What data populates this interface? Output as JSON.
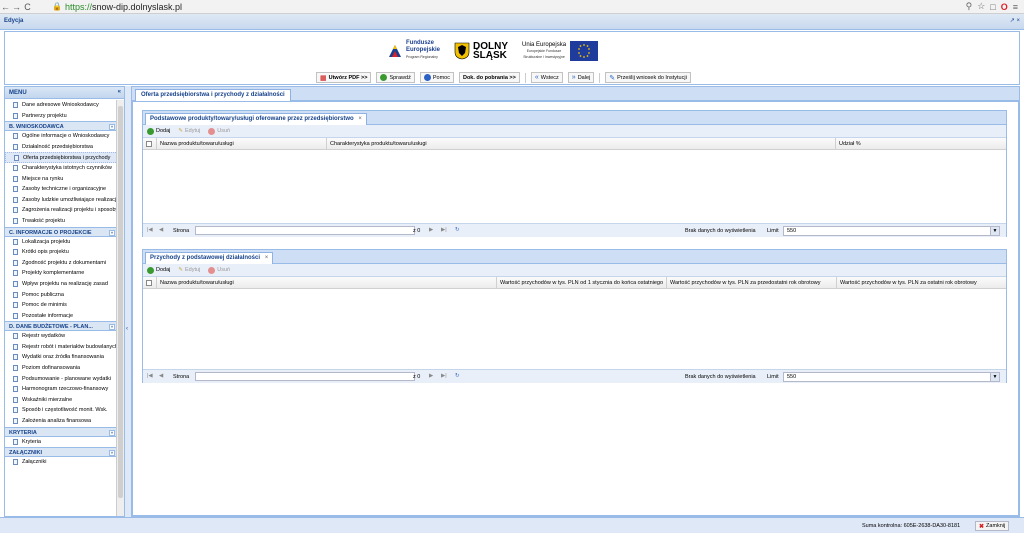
{
  "browser": {
    "back": "←",
    "forward": "→",
    "reload": "C",
    "url_proto": "https://",
    "url_host": "snow-dip.dolnyslask.pl"
  },
  "app": {
    "title": "Edycja",
    "window_icons": "↗ ×"
  },
  "header": {
    "fe_title1": "Fundusze",
    "fe_title2": "Europejskie",
    "fe_sub": "Program Regionalny",
    "ds_line1": "DOLNY",
    "ds_line2": "ŚLĄSK",
    "ue_title": "Unia Europejska",
    "ue_sub1": "Europejskie Fundusze",
    "ue_sub2": "Strukturalne i Inwestycyjne"
  },
  "toolbar": {
    "pdf": "Utwórz PDF >>",
    "check": "Sprawdź",
    "help": "Pomoc",
    "docs": "Dok. do pobrania >>",
    "back": "Wstecz",
    "next": "Dalej",
    "send": "Prześlij wniosek do Instytucji"
  },
  "sidebar": {
    "header": "MENU",
    "collapse": "«",
    "rows": [
      {
        "type": "item",
        "label": "Dane adresowe Wnioskodawcy"
      },
      {
        "type": "item",
        "label": "Partnerzy projektu"
      },
      {
        "type": "group",
        "label": "B. WNIOSKODAWCA"
      },
      {
        "type": "item",
        "label": "Ogólne informacje o Wnioskodawcy"
      },
      {
        "type": "item",
        "label": "Działalność przedsiębiorstwa"
      },
      {
        "type": "item",
        "label": "Oferta przedsiębiorstwa i przychody",
        "selected": true
      },
      {
        "type": "item",
        "label": "Charakterystyka istotnych czynników"
      },
      {
        "type": "item",
        "label": "Miejsce na rynku"
      },
      {
        "type": "item",
        "label": "Zasoby techniczne i organizacyjne"
      },
      {
        "type": "item",
        "label": "Zasoby ludzkie umożliwiające realizację"
      },
      {
        "type": "item",
        "label": "Zagrożenia realizacji projektu i sposoby"
      },
      {
        "type": "item",
        "label": "Trwałość projektu"
      },
      {
        "type": "group",
        "label": "C. INFORMACJE O PROJEKCIE"
      },
      {
        "type": "item",
        "label": "Lokalizacja projektu"
      },
      {
        "type": "item",
        "label": "Krótki opis projektu"
      },
      {
        "type": "item",
        "label": "Zgodność projektu z dokumentami"
      },
      {
        "type": "item",
        "label": "Projekty komplementarne"
      },
      {
        "type": "item",
        "label": "Wpływ projektu na realizację zasad"
      },
      {
        "type": "item",
        "label": "Pomoc publiczna"
      },
      {
        "type": "item",
        "label": "Pomoc de minimis"
      },
      {
        "type": "item",
        "label": "Pozostałe informacje"
      },
      {
        "type": "group",
        "label": "D. DANE BUDŻETOWE - PLAN..."
      },
      {
        "type": "item",
        "label": "Rejestr wydatków"
      },
      {
        "type": "item",
        "label": "Rejestr robót i materiałów budowlanych"
      },
      {
        "type": "item",
        "label": "Wydatki oraz źródła finansowania"
      },
      {
        "type": "item",
        "label": "Poziom dofinansowania"
      },
      {
        "type": "item",
        "label": "Podsumowanie - planowane wydatki"
      },
      {
        "type": "item",
        "label": "Harmonogram rzeczowo-finansowy"
      },
      {
        "type": "item",
        "label": "Wskaźniki mierzalne"
      },
      {
        "type": "item",
        "label": "Sposób i częstotliwość monit. Wsk."
      },
      {
        "type": "item",
        "label": "Założenia analiza finansowa"
      },
      {
        "type": "group",
        "label": "KRYTERIA"
      },
      {
        "type": "item",
        "label": "Kryteria"
      },
      {
        "type": "group",
        "label": "ZAŁĄCZNIKI"
      },
      {
        "type": "item",
        "label": "Załączniki"
      }
    ]
  },
  "main": {
    "tab_label": "Oferta przedsiębiorstwa i przychody z działalności",
    "grid1": {
      "tab": "Podstawowe produkty/towary/usługi oferowane przez przedsiębiorstwo",
      "add": "Dodaj",
      "edit": "Edytuj",
      "delete": "Usuń",
      "col1": "Nazwa produktu/towaru/usługi",
      "col2": "Charakterystyka produktu/towaru/usługi",
      "col3": "Udział %",
      "page_label": "Strona",
      "page_of": "z 0",
      "empty": "Brak danych do wyświetlenia",
      "limit_label": "Limit",
      "limit_value": "550"
    },
    "grid2": {
      "tab": "Przychody z podstawowej działalności",
      "add": "Dodaj",
      "edit": "Edytuj",
      "delete": "Usuń",
      "col1": "Nazwa produktu/towaru/usługi",
      "col2": "Wartość przychodów w tys. PLN od 1 stycznia do końca ostatniego",
      "col3": "Wartość przychodów w tys. PLN za przedostatni rok obrotowy",
      "col4": "Wartość przychodów w tys. PLN za ostatni rok obrotowy",
      "page_label": "Strona",
      "page_of": "z 0",
      "empty": "Brak danych do wyświetlenia",
      "limit_label": "Limit",
      "limit_value": "550"
    }
  },
  "status": {
    "checksum": "Suma kontrolna: 605E-2638-DA30-8181",
    "close": "Zamknij"
  },
  "colors": {
    "accent": "#15428b",
    "panel": "#dfe8f6",
    "border": "#99bbe8",
    "add_green": "#3a9a2f",
    "delete_red": "#d32020"
  }
}
